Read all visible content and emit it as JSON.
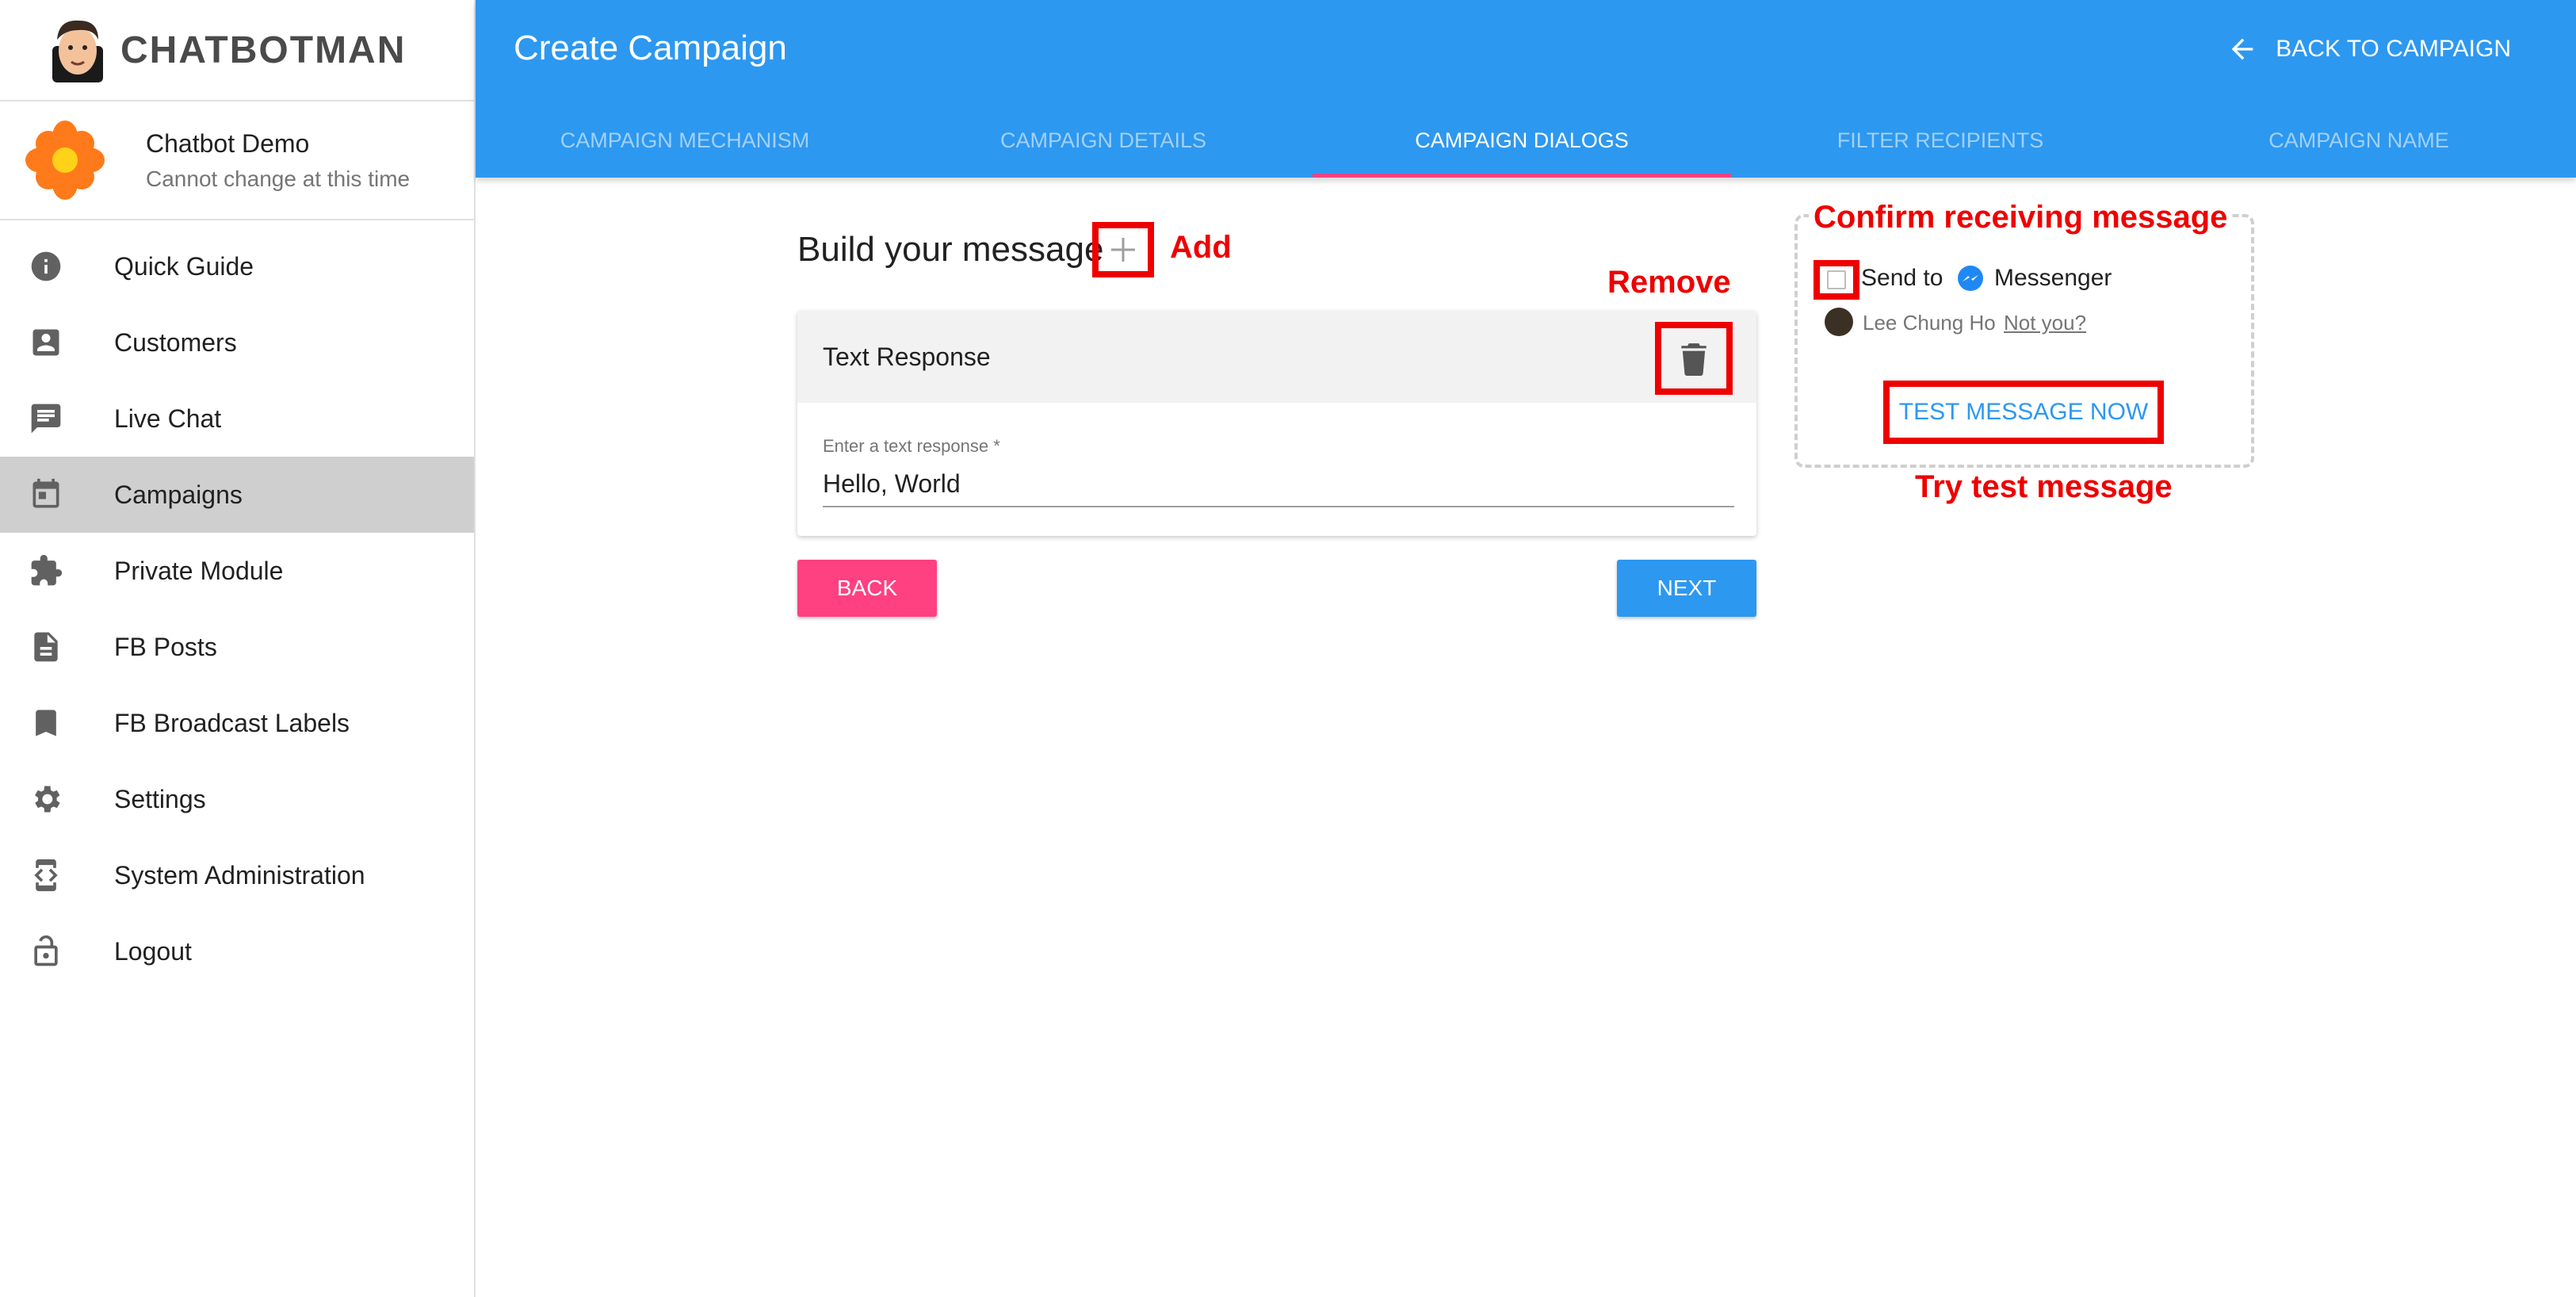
{
  "sidebar": {
    "brand": "CHATBOTMAN",
    "profile": {
      "name": "Chatbot Demo",
      "subtitle": "Cannot change at this time"
    },
    "items": [
      {
        "label": "Quick Guide",
        "icon": "info-icon"
      },
      {
        "label": "Customers",
        "icon": "contact-card-icon"
      },
      {
        "label": "Live Chat",
        "icon": "chat-bubble-icon"
      },
      {
        "label": "Campaigns",
        "icon": "calendar-icon",
        "active": true
      },
      {
        "label": "Private Module",
        "icon": "puzzle-icon"
      },
      {
        "label": "FB Posts",
        "icon": "document-icon"
      },
      {
        "label": "FB Broadcast Labels",
        "icon": "bookmark-icon"
      },
      {
        "label": "Settings",
        "icon": "gear-icon"
      },
      {
        "label": "System Administration",
        "icon": "developer-mode-icon"
      },
      {
        "label": "Logout",
        "icon": "lock-open-icon"
      }
    ]
  },
  "header": {
    "title": "Create Campaign",
    "back_label": "BACK TO CAMPAIGN",
    "tabs": [
      {
        "label": "CAMPAIGN MECHANISM"
      },
      {
        "label": "CAMPAIGN DETAILS"
      },
      {
        "label": "CAMPAIGN DIALOGS",
        "active": true
      },
      {
        "label": "FILTER RECIPIENTS"
      },
      {
        "label": "CAMPAIGN NAME"
      }
    ]
  },
  "main": {
    "build_title": "Build your message",
    "card": {
      "title": "Text Response",
      "field_label": "Enter a text response *",
      "field_value": "Hello, World"
    },
    "back_button": "BACK",
    "next_button": "NEXT"
  },
  "test_panel": {
    "send_to": "Send to",
    "channel": "Messenger",
    "user_name": "Lee Chung Ho",
    "not_you": "Not you?",
    "test_button": "TEST MESSAGE NOW"
  },
  "annotations": {
    "add": "Add",
    "remove": "Remove",
    "confirm": "Confirm receiving message",
    "try_test": "Try test message"
  },
  "colors": {
    "primary": "#2d98f0",
    "accent": "#ff4081",
    "annotation_red": "#ee0000",
    "active_nav": "#cfcfcf"
  }
}
